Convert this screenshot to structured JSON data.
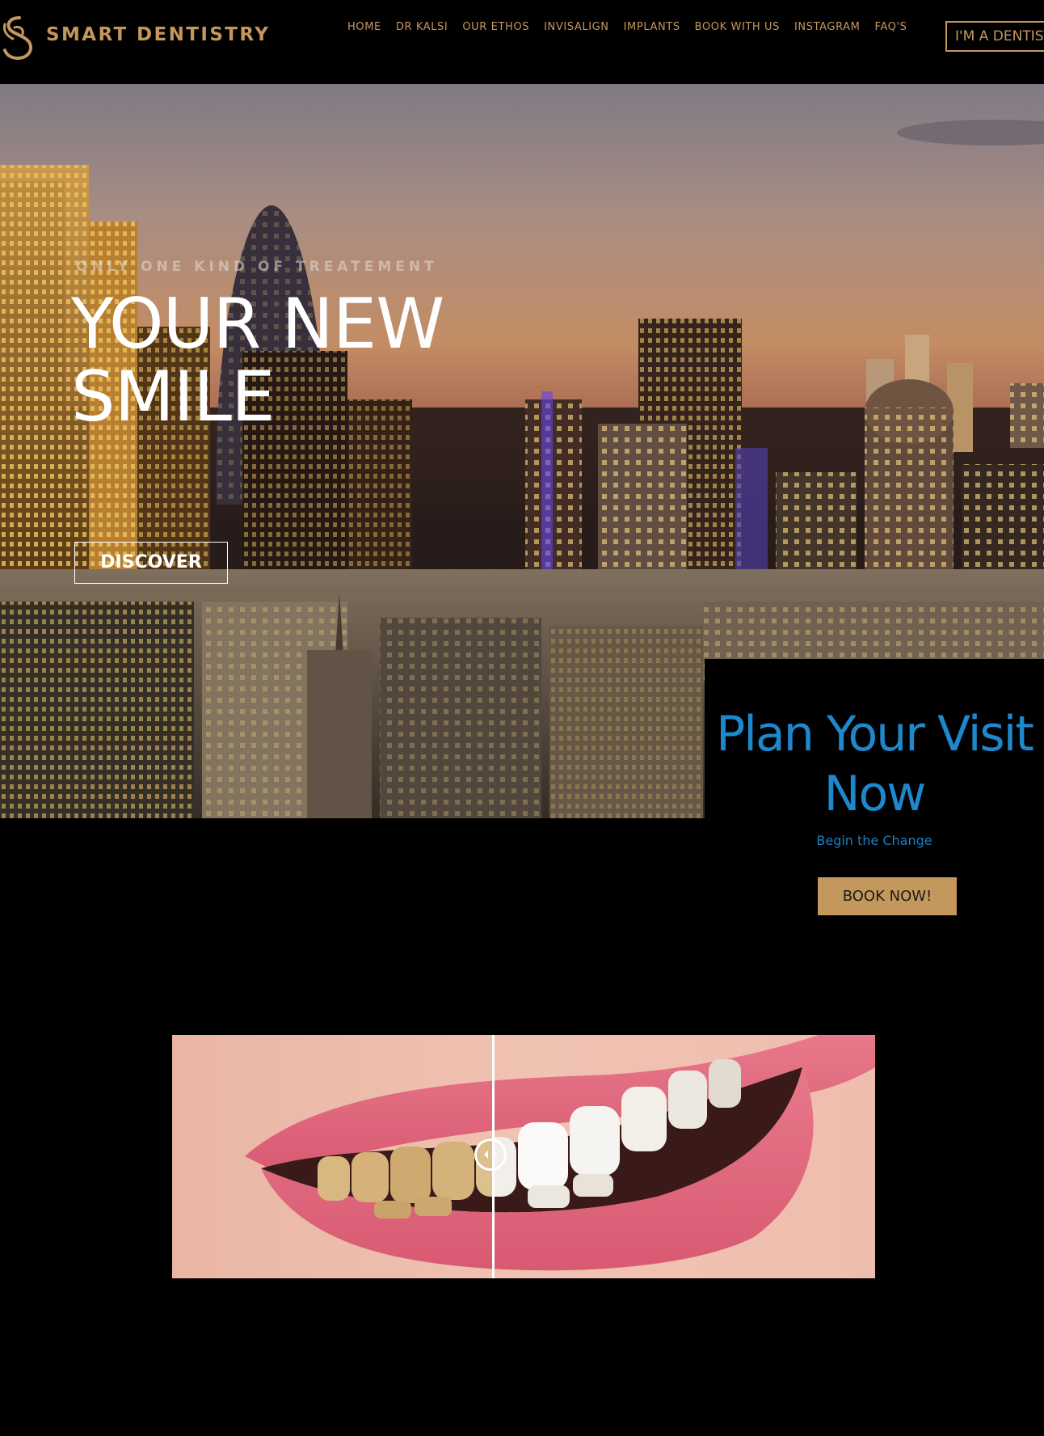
{
  "brand": {
    "name": "SMART DENTISTRY",
    "accent": "#c4975c"
  },
  "nav": {
    "items": [
      {
        "label": "HOME"
      },
      {
        "label": "DR KALSI"
      },
      {
        "label": "OUR ETHOS"
      },
      {
        "label": "INVISALIGN"
      },
      {
        "label": "IMPLANTS"
      },
      {
        "label": "BOOK WITH US"
      },
      {
        "label": "INSTAGRAM"
      },
      {
        "label": "FAQ'S"
      }
    ],
    "dentist_button": "I'M A DENTIST"
  },
  "hero": {
    "eyebrow": "ONLY ONE KIND OF TREATEMENT",
    "title": "YOUR NEW SMILE",
    "discover_button": "DISCOVER"
  },
  "plan": {
    "title": "Plan Your Visit Now",
    "subtitle": "Begin the Change",
    "book_button": "BOOK NOW!",
    "title_color": "#1e88cc"
  },
  "compare": {
    "slider_position": 0.456
  }
}
